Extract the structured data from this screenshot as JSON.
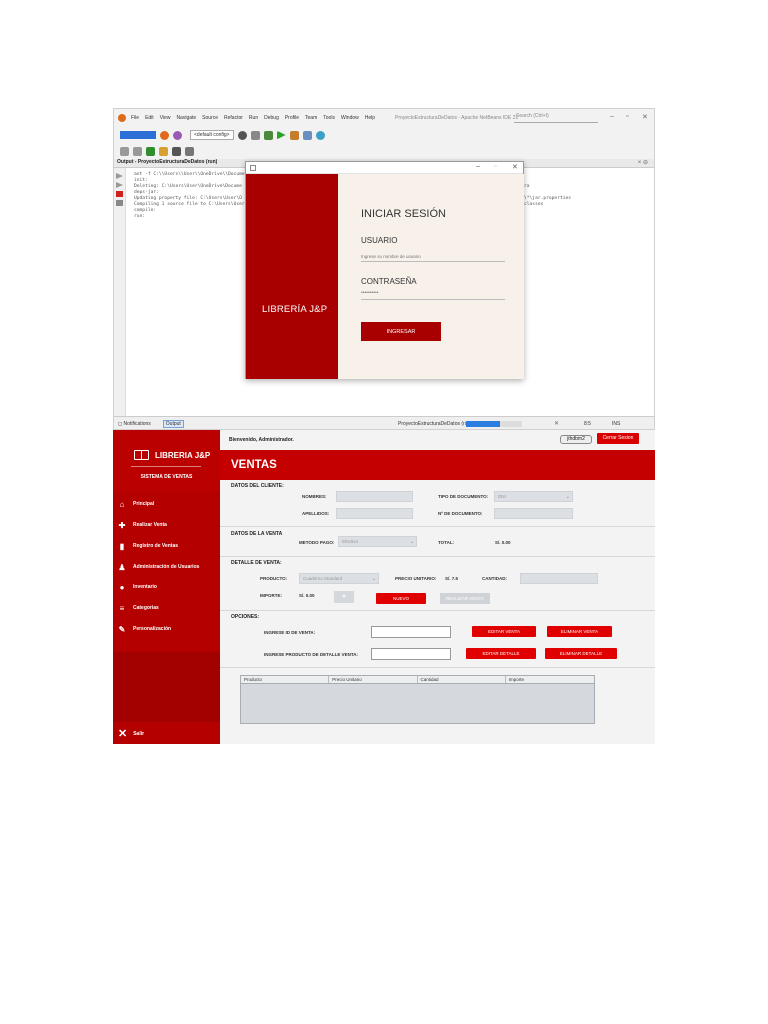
{
  "ide": {
    "menu": [
      "File",
      "Edit",
      "View",
      "Navigate",
      "Source",
      "Refactor",
      "Run",
      "Debug",
      "Profile",
      "Team",
      "Tools",
      "Window",
      "Help"
    ],
    "window_title": "ProyectoEstructuraDeDatos - Apache NetBeans IDE 21",
    "search_placeholder": "Search (Ctrl+I)",
    "config": "<default config>",
    "output_title": "Output - ProyectoEstructuraDeDatos (run)",
    "console_lines": [
      "ant -f C:\\\\Users\\\\User\\\\OneDrive\\\\Docume",
      "init:",
      "Deleting: C:\\Users\\User\\OneDrive\\Docume",
      "deps-jar:",
      "Updating property file: C:\\Users\\User\\O",
      "Compiling 1 source file to C:\\Users\\User",
      "compile:",
      "run:"
    ],
    "console_right": [
      "",
      "",
      "ra",
      "",
      "\\*\\jar.properties",
      "classes"
    ],
    "status_tabs": [
      "Notifications",
      "Output"
    ],
    "progress_label": "ProyectoEstructuraDeDatos (run)",
    "progress": 0.6,
    "caret": "8:5",
    "mode": "INS"
  },
  "login": {
    "brand": "LIBRERÍA J&P",
    "heading": "INICIAR SESIÓN",
    "user_label": "USUARIO",
    "user_placeholder": "Ingrese su nombre de usuario",
    "pass_label": "CONTRASEÑA",
    "pass_value": "••••••••••",
    "button": "INGRESAR"
  },
  "app": {
    "brand": "LIBRERIA J&P",
    "subtitle": "SISTEMA DE VENTAS",
    "nav": [
      {
        "label": "Principal",
        "icon": "home-icon"
      },
      {
        "label": "Realizar Venta",
        "icon": "plus-icon"
      },
      {
        "label": "Registro de Ventas",
        "icon": "document-icon"
      },
      {
        "label": "Administración de Usuarios",
        "icon": "user-icon"
      },
      {
        "label": "Inventario",
        "icon": "box-icon"
      },
      {
        "label": "Categorias",
        "icon": "list-icon"
      },
      {
        "label": "Personalización",
        "icon": "brush-icon"
      }
    ],
    "exit": "Salir",
    "welcome": "Bienvenido, Administrador.",
    "user_badge": "jthdbm2",
    "logout": "Cerrar Sesion",
    "title": "VENTAS",
    "sec_cliente": "DATOS DEL CLIENTE:",
    "nombres": "NOMBRES:",
    "apellidos": "APELLIDOS:",
    "tipo_doc": "TIPO DE DOCUMENTO:",
    "tipo_doc_val": "DNI",
    "num_doc": "Nº DE DOCUMENTO:",
    "sec_venta": "DATOS DE LA VENTA",
    "metodo": "METODO PAGO:",
    "metodo_val": "Efectivo",
    "total_lbl": "TOTAL:",
    "total_val": "S/. 0.00",
    "sec_detalle": "DETALLE DE VENTA:",
    "producto": "PRODUCTO:",
    "producto_val": "Cuaderno Standard",
    "precio_lbl": "PRECIO UNITARIO:",
    "precio_val": "S/. 7.5",
    "cantidad": "CANTIDAD:",
    "importe_lbl": "IMPORTE:",
    "importe_val": "S/. 0.00",
    "nuevo": "NUEVO",
    "realizar": "REALIZAR VENTA",
    "sec_opciones": "OPCIONES:",
    "id_venta": "INGRESE ID DE VENTA:",
    "editar_venta": "EDITAR VENTA",
    "eliminar_venta": "ELIMINAR VENTA",
    "prod_detalle": "INGRESE PRODUCTO DE DETALLE VENTA:",
    "editar_detalle": "EDITAR DETALLE",
    "eliminar_detalle": "ELIMINAR DETALLE",
    "table_headers": [
      "Producto",
      "Precio Unitario",
      "Cantidad",
      "Importe"
    ]
  }
}
